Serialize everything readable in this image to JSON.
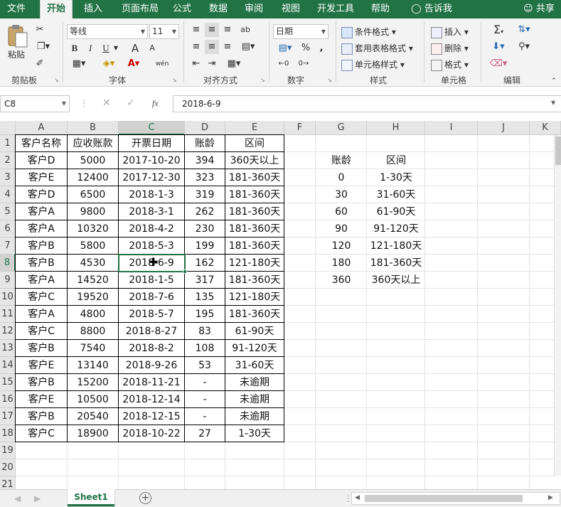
{
  "menu": {
    "tabs": [
      "文件",
      "开始",
      "插入",
      "页面布局",
      "公式",
      "数据",
      "审阅",
      "视图",
      "开发工具",
      "帮助"
    ],
    "tell_me": "告诉我",
    "share": "共享",
    "active": "开始"
  },
  "ribbon": {
    "clipboard": {
      "label": "剪贴板",
      "paste": "粘贴"
    },
    "font": {
      "label": "字体",
      "family": "等线",
      "size": "11",
      "bold": "B",
      "italic": "I",
      "underline": "U",
      "grow": "A",
      "shrink": "A",
      "phonetic": "wén"
    },
    "alignment": {
      "label": "对齐方式"
    },
    "number": {
      "label": "数字",
      "format": "日期",
      "percent": "%",
      "comma": ","
    },
    "styles": {
      "label": "样式",
      "conditional": "条件格式",
      "table": "套用表格格式",
      "cell": "单元格样式"
    },
    "cells": {
      "label": "单元格",
      "insert": "插入",
      "delete": "删除",
      "format": "格式"
    },
    "editing": {
      "label": "编辑",
      "sum": "Σ"
    }
  },
  "formula_bar": {
    "name_box": "C8",
    "fx": "fx",
    "content": "2018-6-9"
  },
  "columns": [
    "A",
    "B",
    "C",
    "D",
    "E",
    "F",
    "G",
    "H",
    "I",
    "J",
    "K"
  ],
  "rows": [
    "1",
    "2",
    "3",
    "4",
    "5",
    "6",
    "7",
    "8",
    "9",
    "10",
    "11",
    "12",
    "13",
    "14",
    "15",
    "16",
    "17",
    "18",
    "19",
    "20",
    "21"
  ],
  "selected_cell": {
    "column": "C",
    "row": "8"
  },
  "table": {
    "headers": [
      "客户名称",
      "应收账款",
      "开票日期",
      "账龄",
      "区间"
    ],
    "rows": [
      [
        "客户D",
        "5000",
        "2017-10-20",
        "394",
        "360天以上"
      ],
      [
        "客户E",
        "12400",
        "2017-12-30",
        "323",
        "181-360天"
      ],
      [
        "客户D",
        "6500",
        "2018-1-3",
        "319",
        "181-360天"
      ],
      [
        "客户A",
        "9800",
        "2018-3-1",
        "262",
        "181-360天"
      ],
      [
        "客户A",
        "10320",
        "2018-4-2",
        "230",
        "181-360天"
      ],
      [
        "客户B",
        "5800",
        "2018-5-3",
        "199",
        "181-360天"
      ],
      [
        "客户B",
        "4530",
        "2018-6-9",
        "162",
        "121-180天"
      ],
      [
        "客户A",
        "14520",
        "2018-1-5",
        "317",
        "181-360天"
      ],
      [
        "客户C",
        "19520",
        "2018-7-6",
        "135",
        "121-180天"
      ],
      [
        "客户A",
        "4800",
        "2018-5-7",
        "195",
        "181-360天"
      ],
      [
        "客户C",
        "8800",
        "2018-8-27",
        "83",
        "61-90天"
      ],
      [
        "客户B",
        "7540",
        "2018-8-2",
        "108",
        "91-120天"
      ],
      [
        "客户E",
        "13140",
        "2018-9-26",
        "53",
        "31-60天"
      ],
      [
        "客户B",
        "15200",
        "2018-11-21",
        "-",
        "未逾期"
      ],
      [
        "客户E",
        "10500",
        "2018-12-14",
        "-",
        "未逾期"
      ],
      [
        "客户B",
        "20540",
        "2018-12-15",
        "-",
        "未逾期"
      ],
      [
        "客户C",
        "18900",
        "2018-10-22",
        "27",
        "1-30天"
      ]
    ]
  },
  "lookup": {
    "headers": [
      "账龄",
      "区间"
    ],
    "rows": [
      [
        "0",
        "1-30天"
      ],
      [
        "30",
        "31-60天"
      ],
      [
        "60",
        "61-90天"
      ],
      [
        "90",
        "91-120天"
      ],
      [
        "120",
        "121-180天"
      ],
      [
        "180",
        "181-360天"
      ],
      [
        "360",
        "360天以上"
      ]
    ]
  },
  "sheet_tabs": {
    "active": "Sheet1"
  },
  "colors": {
    "excel_green": "#217346",
    "border": "#000000"
  }
}
